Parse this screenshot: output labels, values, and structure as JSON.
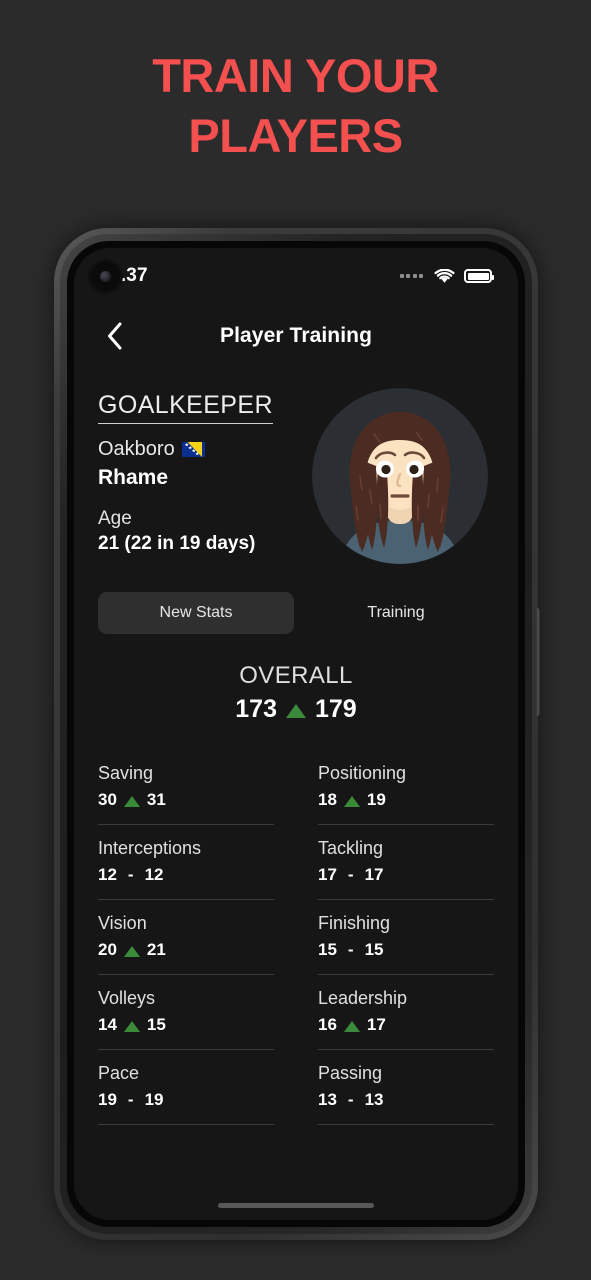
{
  "promo": {
    "line1": "TRAIN YOUR",
    "line2": "PLAYERS",
    "color": "#f4504f"
  },
  "status_bar": {
    "time": "2.37",
    "signal_icon": "signal-dots-icon",
    "wifi_icon": "wifi-icon",
    "battery_icon": "battery-full-icon"
  },
  "header": {
    "back_icon": "chevron-left-icon",
    "title": "Player Training"
  },
  "player": {
    "position": "GOALKEEPER",
    "club": "Oakboro",
    "flag_icon": "flag-bosnia-herzegovina-icon",
    "name": "Rhame",
    "age_label": "Age",
    "age_value": "21 (22 in 19 days)",
    "avatar_icon": "player-avatar-icon"
  },
  "tabs": [
    {
      "label": "New Stats",
      "active": true
    },
    {
      "label": "Training",
      "active": false
    }
  ],
  "overall": {
    "label": "OVERALL",
    "before": "173",
    "after": "179",
    "change": "up",
    "up_color": "#3a8a3a"
  },
  "stats": [
    {
      "name": "Saving",
      "before": "30",
      "after": "31",
      "change": "up"
    },
    {
      "name": "Positioning",
      "before": "18",
      "after": "19",
      "change": "up"
    },
    {
      "name": "Interceptions",
      "before": "12",
      "after": "12",
      "change": "none"
    },
    {
      "name": "Tackling",
      "before": "17",
      "after": "17",
      "change": "none"
    },
    {
      "name": "Vision",
      "before": "20",
      "after": "21",
      "change": "up"
    },
    {
      "name": "Finishing",
      "before": "15",
      "after": "15",
      "change": "none"
    },
    {
      "name": "Volleys",
      "before": "14",
      "after": "15",
      "change": "up"
    },
    {
      "name": "Leadership",
      "before": "16",
      "after": "17",
      "change": "up"
    },
    {
      "name": "Pace",
      "before": "19",
      "after": "19",
      "change": "none"
    },
    {
      "name": "Passing",
      "before": "13",
      "after": "13",
      "change": "none"
    }
  ],
  "separator": "-",
  "home_indicator": "home-indicator"
}
